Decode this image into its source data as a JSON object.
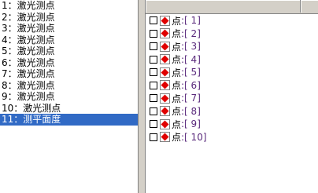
{
  "left_list": {
    "items": [
      "1：激光测点",
      "2：激光测点",
      "3：激光测点",
      "4：激光测点",
      "5：激光测点",
      "6：激光测点",
      "7：激光测点",
      "8：激光测点",
      "9：激光测点",
      "10：激光测点",
      "11：测平面度"
    ],
    "selected_index": 10
  },
  "right_list": {
    "rows": [
      {
        "label": "点",
        "num": ":[ 1]"
      },
      {
        "label": "点",
        "num": ":[ 2]"
      },
      {
        "label": "点",
        "num": ":[ 3]"
      },
      {
        "label": "点",
        "num": ":[ 4]"
      },
      {
        "label": "点",
        "num": ":[ 5]"
      },
      {
        "label": "点",
        "num": ":[ 6]"
      },
      {
        "label": "点",
        "num": ":[ 7]"
      },
      {
        "label": "点",
        "num": ":[ 8]"
      },
      {
        "label": "点",
        "num": ":[ 9]"
      },
      {
        "label": "点",
        "num": ":[ 10]"
      }
    ],
    "icon": "red-diamond-point-icon"
  },
  "colors": {
    "selection": "#316ac5",
    "point_number": "#5a2a7c",
    "icon_red": "#e00000"
  }
}
